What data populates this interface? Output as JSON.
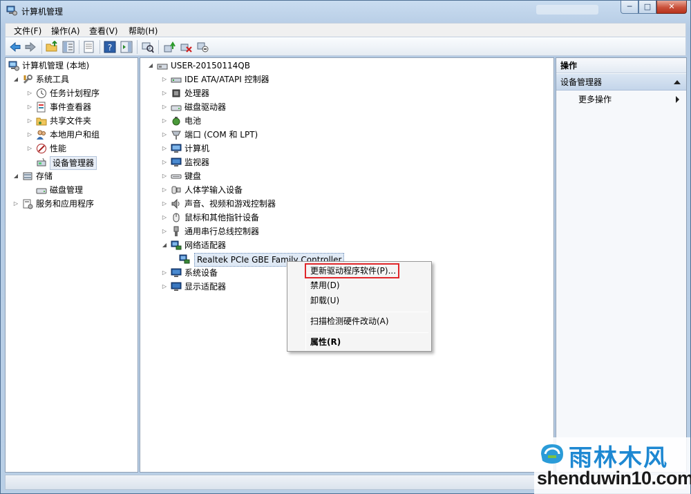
{
  "window": {
    "title": "计算机管理",
    "min": "─",
    "max": "□",
    "close": "✕"
  },
  "menu": [
    "文件(F)",
    "操作(A)",
    "查看(V)",
    "帮助(H)"
  ],
  "left_tree": {
    "root": "计算机管理 (本地)",
    "system_tools": "系统工具",
    "task_scheduler": "任务计划程序",
    "event_viewer": "事件查看器",
    "shared_folders": "共享文件夹",
    "local_users": "本地用户和组",
    "performance": "性能",
    "device_manager": "设备管理器",
    "storage": "存储",
    "disk_management": "磁盘管理",
    "services": "服务和应用程序"
  },
  "device_tree": {
    "computer": "USER-20150114QB",
    "categories": [
      "IDE ATA/ATAPI 控制器",
      "处理器",
      "磁盘驱动器",
      "电池",
      "端口 (COM 和 LPT)",
      "计算机",
      "监视器",
      "键盘",
      "人体学输入设备",
      "声音、视频和游戏控制器",
      "鼠标和其他指针设备",
      "通用串行总线控制器",
      "网络适配器"
    ],
    "network_child": "Realtek PCIe GBE Family Controller",
    "after": [
      "系统设备",
      "显示适配器"
    ]
  },
  "context_menu": {
    "update_driver": "更新驱动程序软件(P)...",
    "disable": "禁用(D)",
    "uninstall": "卸载(U)",
    "scan": "扫描检测硬件改动(A)",
    "properties": "属性(R)"
  },
  "actions": {
    "title": "操作",
    "group": "设备管理器",
    "more": "更多操作"
  },
  "watermark": {
    "cn": "雨林木风",
    "en": "shenduwin10.com"
  }
}
